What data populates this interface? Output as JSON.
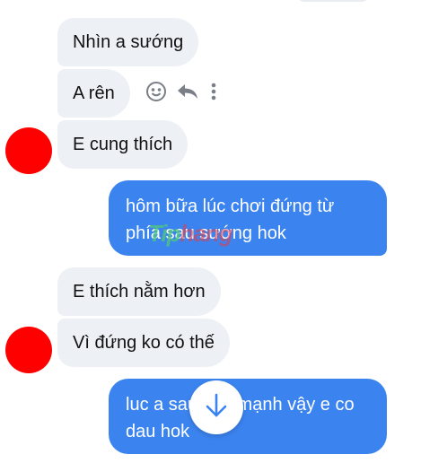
{
  "messages": [
    {
      "text": "Nhìn a sướng"
    },
    {
      "text": "A rên"
    },
    {
      "text": "E cung thích"
    },
    {
      "text": "hôm bữa lúc chơi đứng từ phía sau sướng hok"
    },
    {
      "text": "E thích nằm hơn"
    },
    {
      "text": "Vì đứng ko có thế"
    },
    {
      "text": "luc a sau dập mạnh vậy e co dau hok"
    }
  ],
  "message_actions": [
    "smile-icon",
    "reply-icon",
    "more-vertical-icon"
  ],
  "watermark": {
    "part1": "Tip",
    "part2": "hang"
  },
  "scroll_button": {
    "icon": "arrow-down-icon"
  },
  "colors": {
    "incoming": "#edf0f5",
    "outgoing": "#3b84f0",
    "avatar": "#ff0000",
    "action_icon": "#7a7f87",
    "scroll_arrow": "#3b84f0"
  }
}
